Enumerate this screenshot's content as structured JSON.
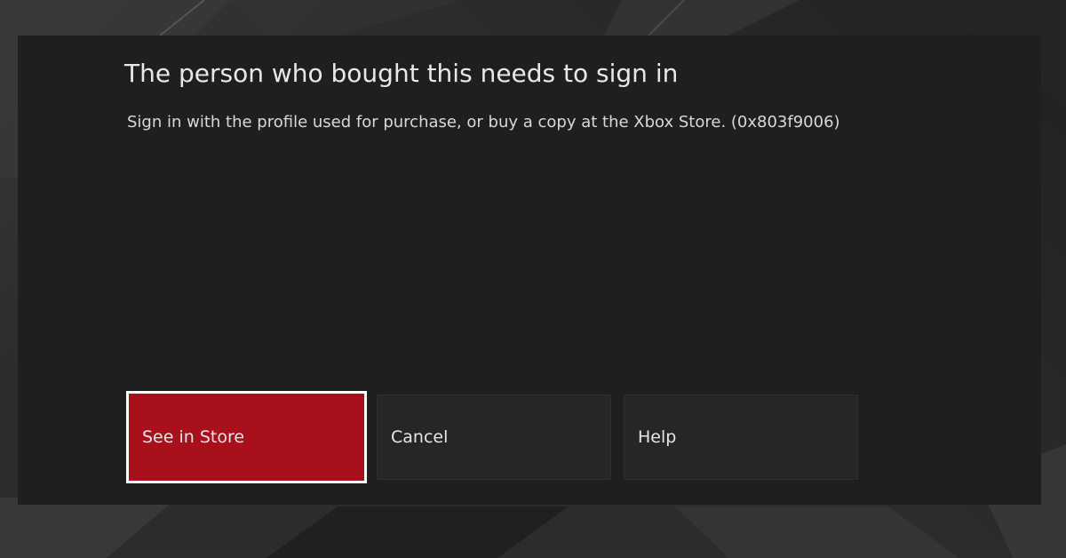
{
  "dialog": {
    "title": "The person who bought this needs to sign in",
    "message": "Sign in with the profile used for purchase, or buy a copy at the Xbox Store. (0x803f9006)",
    "buttons": {
      "store": "See in Store",
      "cancel": "Cancel",
      "help": "Help"
    },
    "focused_button": "store"
  },
  "colors": {
    "dialog_background": "#1f1f1f",
    "primary_button": "#a8101c",
    "focus_border": "#ffffff",
    "text": "#e8e8e8"
  }
}
